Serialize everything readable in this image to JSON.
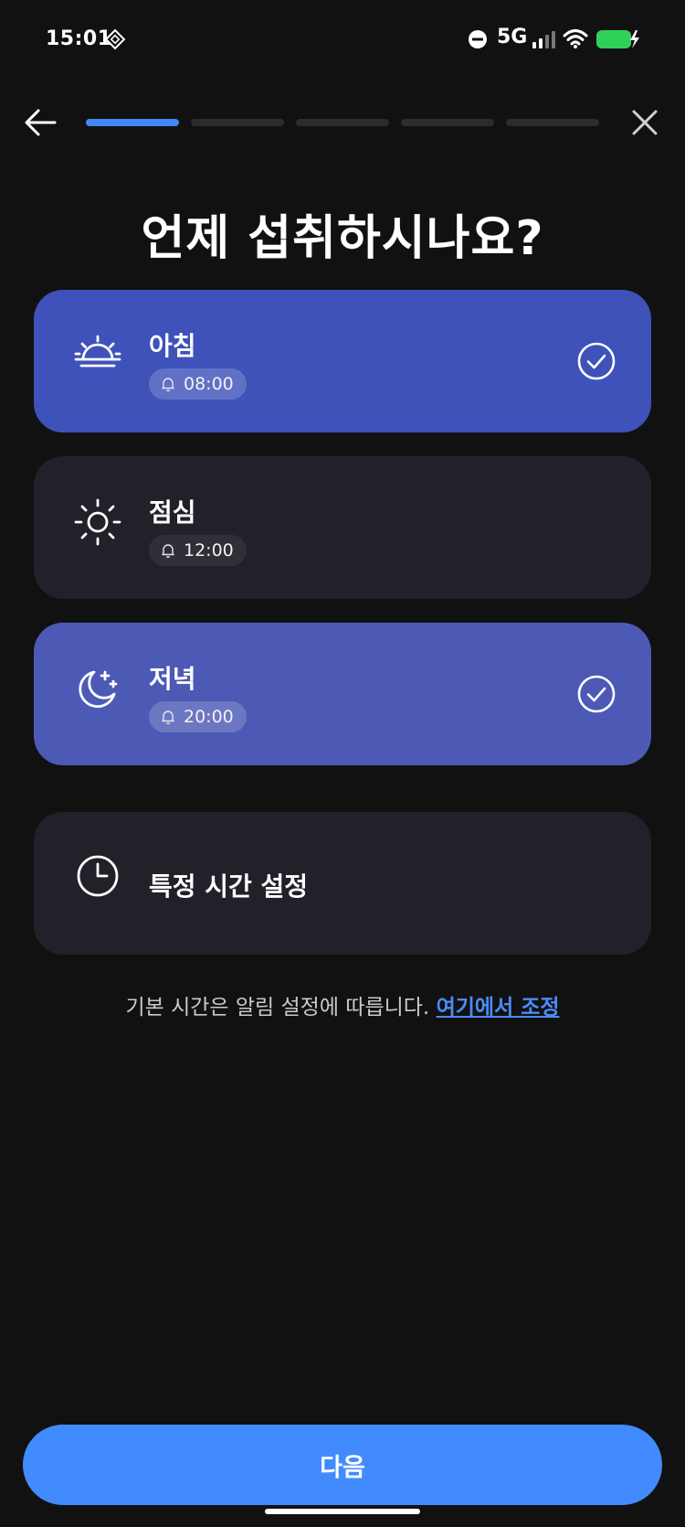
{
  "status_bar": {
    "time": "15:01",
    "network": "5G",
    "battery_color": "#30d158"
  },
  "header": {
    "progress_total": 5,
    "progress_current": 1,
    "progress_color": "#4287f5"
  },
  "title": "언제 섭취하시나요?",
  "options": [
    {
      "label": "아침",
      "time": "08:00",
      "selected": true,
      "icon": "sunrise-icon"
    },
    {
      "label": "점심",
      "time": "12:00",
      "selected": false,
      "icon": "sun-icon"
    },
    {
      "label": "저녁",
      "time": "20:00",
      "selected": true,
      "icon": "moon-stars-icon"
    },
    {
      "label": "특정 시간 설정",
      "selected": false,
      "icon": "clock-icon"
    }
  ],
  "footnote": {
    "text": "기본 시간은 알림 설정에 따릅니다.",
    "link": "여기에서 조정"
  },
  "next_button": "다음",
  "colors": {
    "background": "#111111",
    "card": "#212129",
    "selected_card": "#3f52b9",
    "accent": "#428bff",
    "link": "#4a8df5"
  }
}
